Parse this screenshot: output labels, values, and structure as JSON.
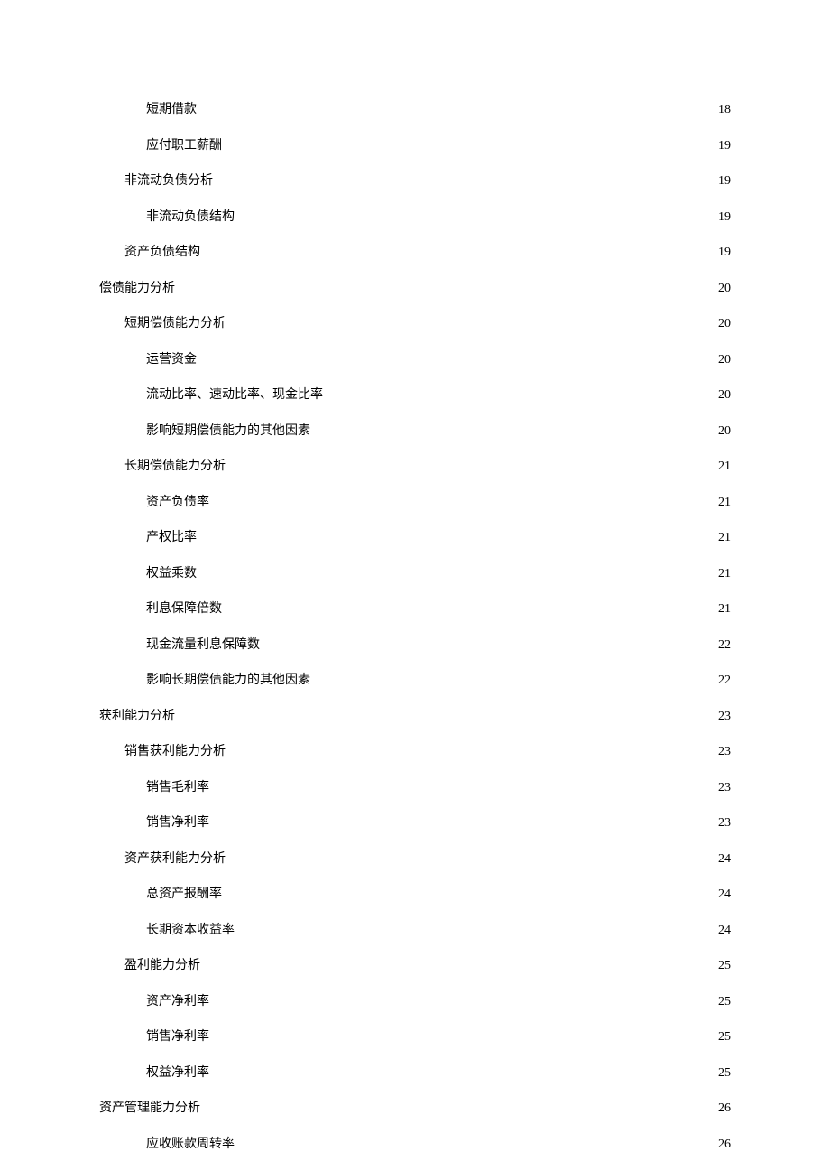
{
  "toc": [
    {
      "title": "短期借款",
      "page": "18",
      "level": 3
    },
    {
      "title": "应付职工薪酬",
      "page": "19",
      "level": 3
    },
    {
      "title": "非流动负债分析",
      "page": "19",
      "level": 2
    },
    {
      "title": "非流动负债结构",
      "page": "19",
      "level": 3
    },
    {
      "title": "资产负债结构",
      "page": "19",
      "level": 2
    },
    {
      "title": "偿债能力分析",
      "page": "20",
      "level": 1
    },
    {
      "title": "短期偿债能力分析",
      "page": "20",
      "level": 2
    },
    {
      "title": "运营资金",
      "page": "20",
      "level": 3
    },
    {
      "title": "流动比率、速动比率、现金比率",
      "page": "20",
      "level": 3
    },
    {
      "title": "影响短期偿债能力的其他因素",
      "page": "20",
      "level": 3
    },
    {
      "title": "长期偿债能力分析",
      "page": "21",
      "level": 2
    },
    {
      "title": "资产负债率",
      "page": "21",
      "level": 3
    },
    {
      "title": "产权比率",
      "page": "21",
      "level": 3
    },
    {
      "title": "权益乘数",
      "page": "21",
      "level": 3
    },
    {
      "title": "利息保障倍数",
      "page": "21",
      "level": 3
    },
    {
      "title": "现金流量利息保障数",
      "page": "22",
      "level": 3
    },
    {
      "title": "影响长期偿债能力的其他因素",
      "page": "22",
      "level": 3
    },
    {
      "title": "获利能力分析",
      "page": "23",
      "level": 1
    },
    {
      "title": "销售获利能力分析",
      "page": "23",
      "level": 2
    },
    {
      "title": "销售毛利率",
      "page": "23",
      "level": 3
    },
    {
      "title": "销售净利率",
      "page": "23",
      "level": 3
    },
    {
      "title": "资产获利能力分析",
      "page": "24",
      "level": 2
    },
    {
      "title": "总资产报酬率",
      "page": "24",
      "level": 3
    },
    {
      "title": "长期资本收益率",
      "page": "24",
      "level": 3
    },
    {
      "title": "盈利能力分析",
      "page": "25",
      "level": 2
    },
    {
      "title": "资产净利率",
      "page": "25",
      "level": 3
    },
    {
      "title": "销售净利率",
      "page": "25",
      "level": 3
    },
    {
      "title": "权益净利率",
      "page": "25",
      "level": 3
    },
    {
      "title": "资产管理能力分析",
      "page": "26",
      "level": 1
    },
    {
      "title": "应收账款周转率",
      "page": "26",
      "level": 3
    }
  ]
}
